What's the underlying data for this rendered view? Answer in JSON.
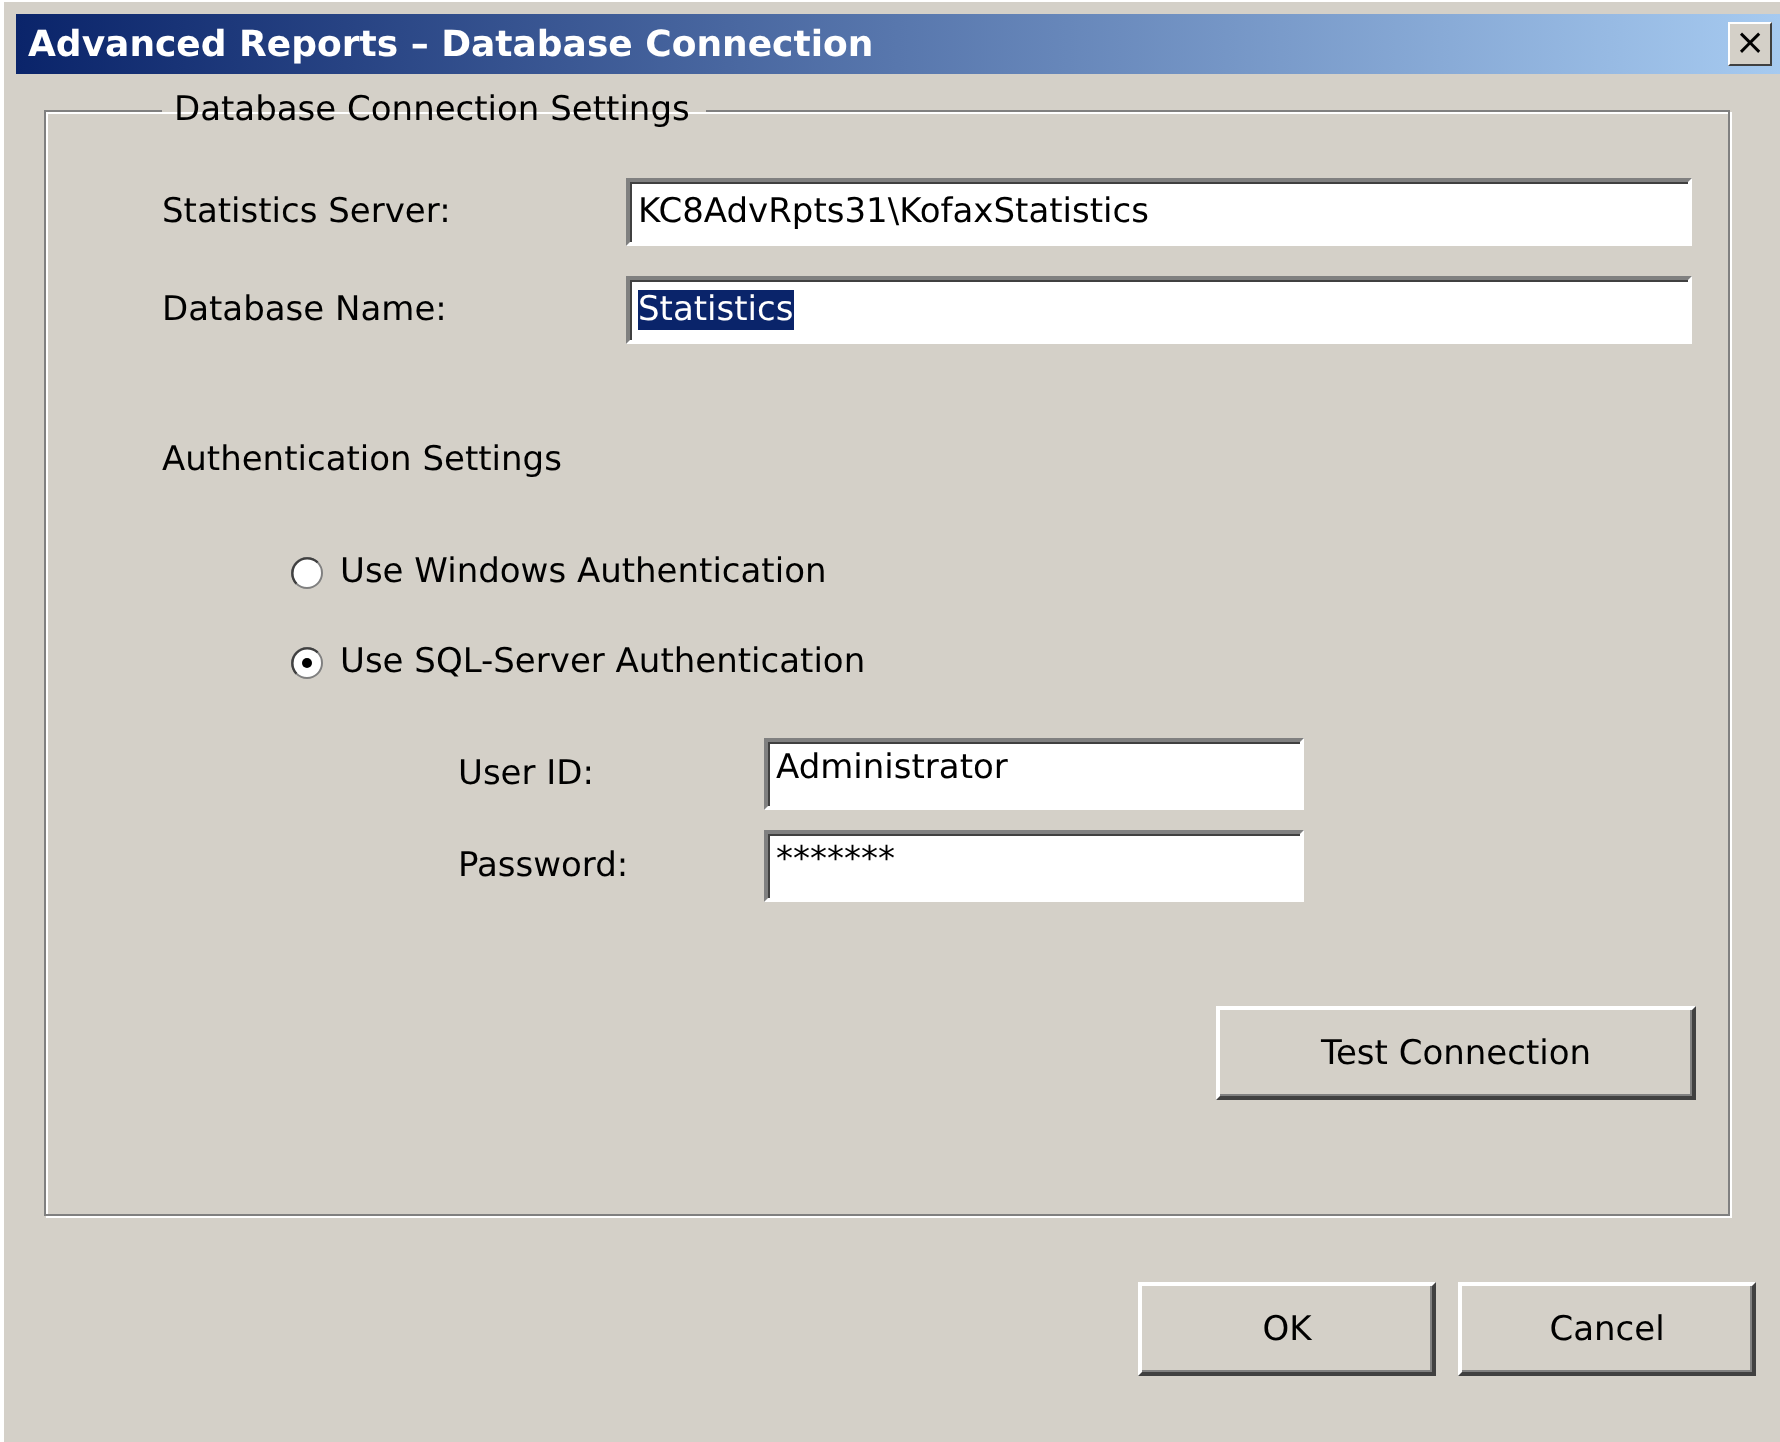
{
  "window": {
    "title": "Advanced Reports – Database Connection",
    "close": "×"
  },
  "group": {
    "title": "Database Connection Settings"
  },
  "fields": [
    {
      "label": "Statistics Server:",
      "value": "KC8AdvRpts31\\KofaxStatistics",
      "selected_text": false
    },
    {
      "label": "Database Name:",
      "value": "Statistics",
      "selected_text": true
    }
  ],
  "auth_heading": "Authentication Settings",
  "auth_options": [
    {
      "label": "Use Windows Authentication",
      "selected": false
    },
    {
      "label": "Use SQL-Server Authentication",
      "selected": true
    }
  ],
  "credentials": [
    {
      "label": "User ID:",
      "value": "Administrator"
    },
    {
      "label": "Password:",
      "value": "*******"
    }
  ],
  "test_button": {
    "label": "Test Connection"
  },
  "buttons": [
    {
      "label": "OK"
    },
    {
      "label": "Cancel"
    }
  ]
}
